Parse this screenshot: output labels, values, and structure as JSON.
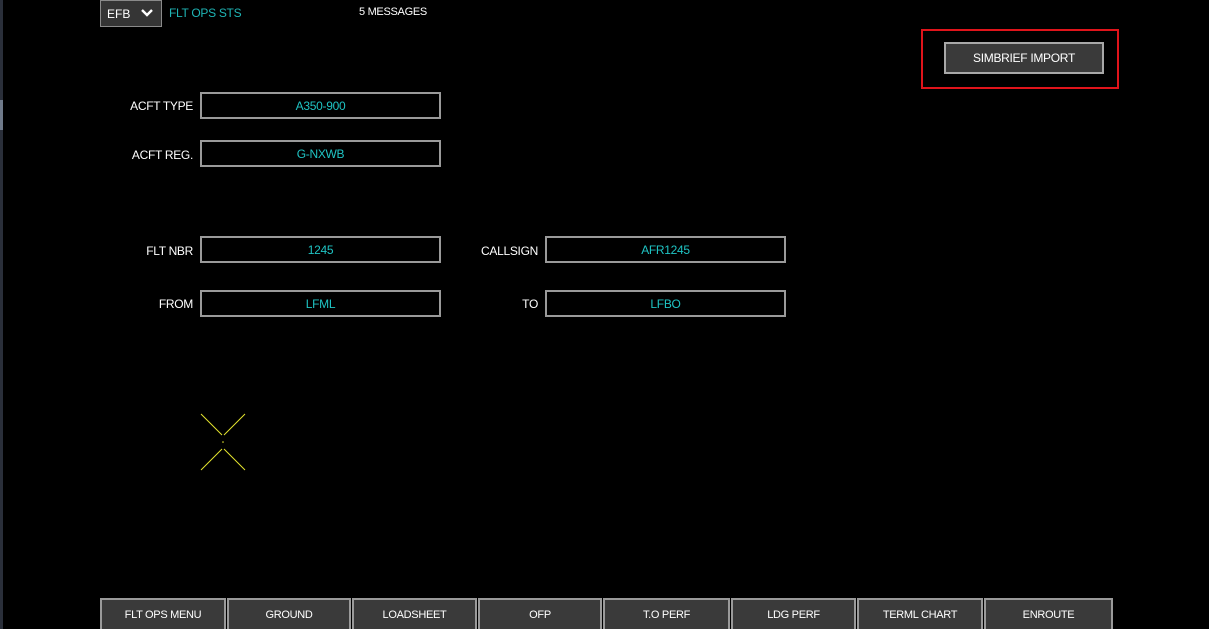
{
  "header": {
    "selector_value": "EFB",
    "app_title": "FLT OPS STS",
    "messages": "5 MESSAGES"
  },
  "toolbar": {
    "import_label": "SIMBRIEF IMPORT"
  },
  "form": {
    "acft_type": {
      "label": "ACFT TYPE",
      "value": "A350-900"
    },
    "acft_reg": {
      "label": "ACFT REG.",
      "value": "G-NXWB"
    },
    "flt_nbr": {
      "label": "FLT NBR",
      "value": "1245"
    },
    "callsign": {
      "label": "CALLSIGN",
      "value": "AFR1245"
    },
    "from": {
      "label": "FROM",
      "value": "LFML"
    },
    "to": {
      "label": "TO",
      "value": "LFBO"
    }
  },
  "nav": {
    "items": [
      {
        "label": "FLT OPS MENU"
      },
      {
        "label": "GROUND"
      },
      {
        "label": "LOADSHEET"
      },
      {
        "label": "OFP"
      },
      {
        "label": "T.O PERF"
      },
      {
        "label": "LDG PERF"
      },
      {
        "label": "TERML CHART"
      },
      {
        "label": "ENROUTE"
      }
    ]
  },
  "colors": {
    "background": "#000000",
    "value_text": "#1fc4c4",
    "title_text": "#1fb5b5",
    "highlight": "#e0141b",
    "cursor": "#e6e62e"
  },
  "icons": {
    "selector": "chevron-down-icon",
    "cursor": "crosshair-cursor-icon"
  }
}
